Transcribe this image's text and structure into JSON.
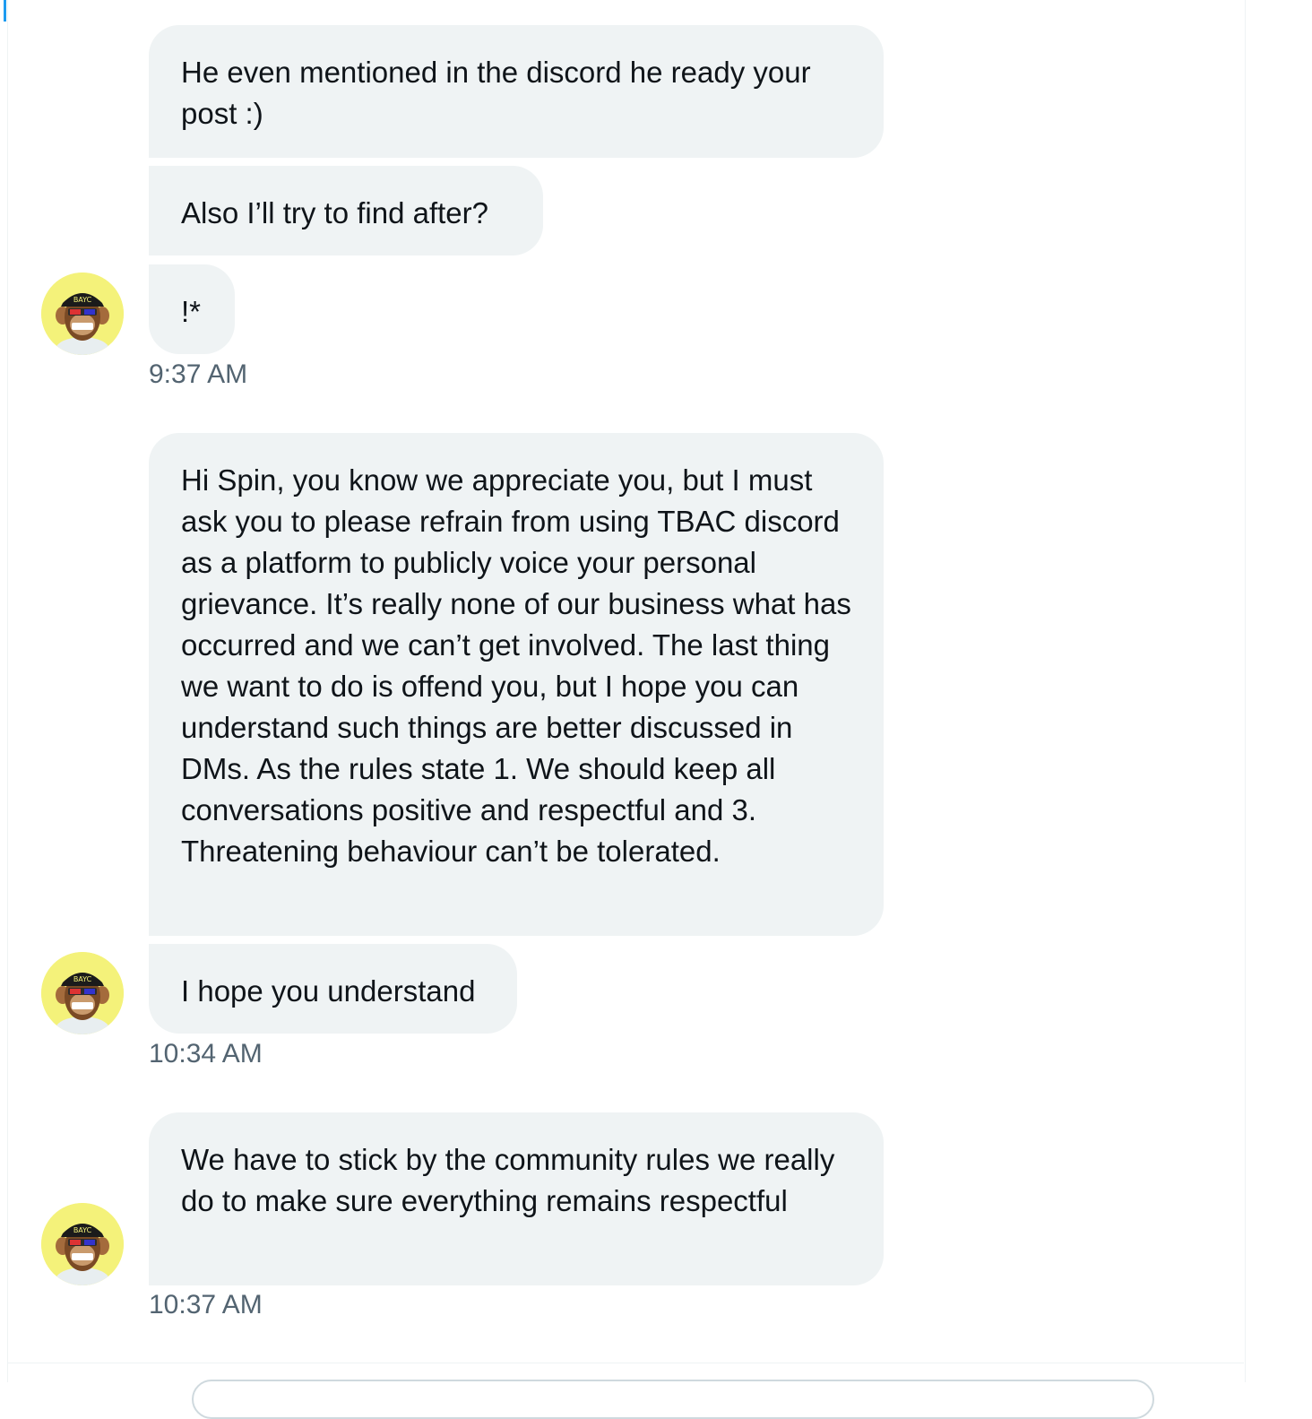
{
  "messages": [
    {
      "text": "He even mentioned in the discord he ready your post :)"
    },
    {
      "text": "Also I’ll try to find after?"
    },
    {
      "text": "!*"
    },
    {
      "text": "Hi Spin, you know we appreciate you, but I must ask you to please refrain from using TBAC discord as a platform to publicly voice your personal grievance. It’s really none of our business what has occurred and we can’t get involved. The last thing we want to do is offend you, but I hope you can understand such things are better discussed in DMs. As the rules state 1. We should keep all conversations positive and respectful and 3. Threatening behaviour can’t be tolerated."
    },
    {
      "text": "I hope you understand"
    },
    {
      "text": "We have to stick by the community rules we really do to make sure everything remains respectful"
    }
  ],
  "timestamps": [
    "9:37 AM",
    "10:34 AM",
    "10:37 AM"
  ],
  "avatar": {
    "icon": "ape-avatar-icon",
    "hat_text": "BAYC"
  },
  "colors": {
    "bubble": "#eff3f4",
    "text": "#0f1419",
    "meta": "#536471",
    "accent": "#1d9bf0"
  }
}
